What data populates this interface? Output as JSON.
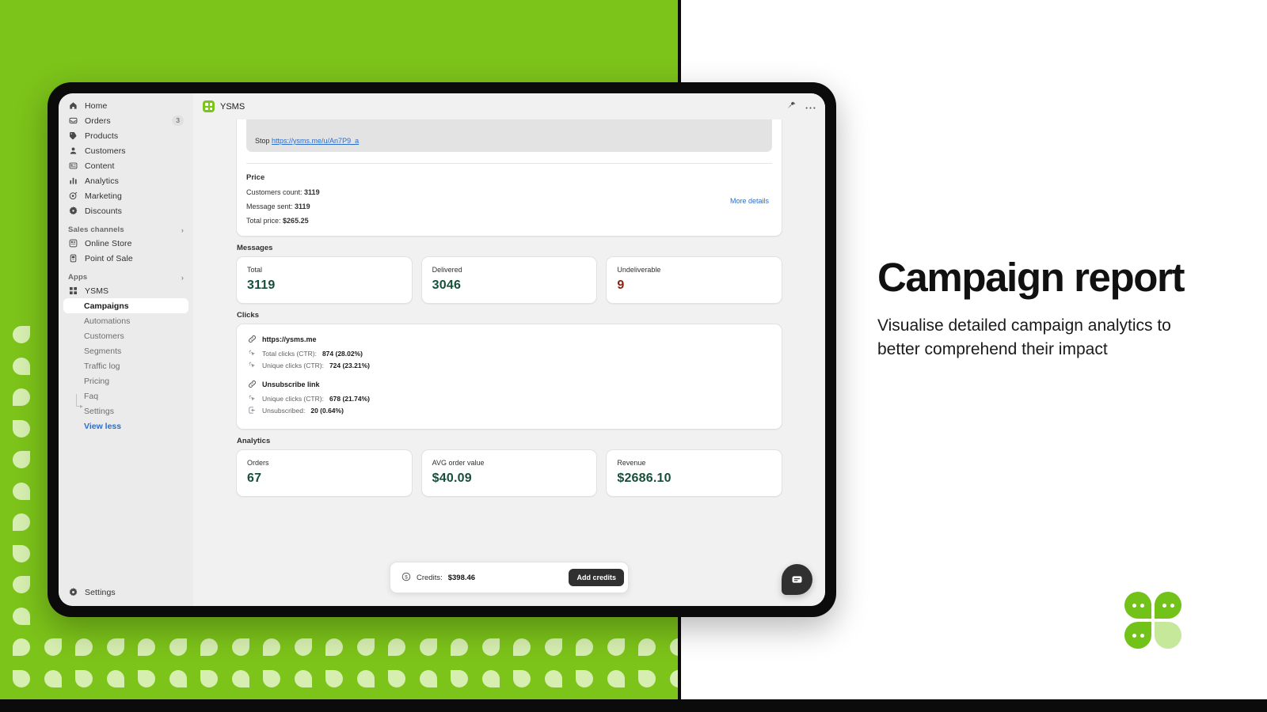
{
  "brand": {
    "green": "#7cc31a",
    "leaf": "#d6eeb0",
    "accent_link": "#2c6ecb",
    "value_green": "#17503a",
    "value_red": "#8e1f0b"
  },
  "topbar": {
    "app_name": "YSMS",
    "pin_icon": "pin-icon",
    "more_icon": "more-horizontal-icon"
  },
  "sidebar": {
    "main_items": [
      {
        "label": "Home",
        "icon": "home-icon",
        "badge": ""
      },
      {
        "label": "Orders",
        "icon": "orders-icon",
        "badge": "3"
      },
      {
        "label": "Products",
        "icon": "products-tag-icon",
        "badge": ""
      },
      {
        "label": "Customers",
        "icon": "customers-person-icon",
        "badge": ""
      },
      {
        "label": "Content",
        "icon": "content-icon",
        "badge": ""
      },
      {
        "label": "Analytics",
        "icon": "analytics-bars-icon",
        "badge": ""
      },
      {
        "label": "Marketing",
        "icon": "marketing-target-icon",
        "badge": ""
      },
      {
        "label": "Discounts",
        "icon": "discounts-icon",
        "badge": ""
      }
    ],
    "sales_channels": {
      "title": "Sales channels",
      "chevron": "›",
      "items": [
        {
          "label": "Online Store",
          "icon": "online-store-icon"
        },
        {
          "label": "Point of Sale",
          "icon": "point-of-sale-icon"
        }
      ]
    },
    "apps": {
      "title": "Apps",
      "chevron": "›",
      "root": {
        "label": "YSMS",
        "icon": "ysms-grid-icon"
      },
      "items": [
        {
          "label": "Campaigns",
          "active": true
        },
        {
          "label": "Automations",
          "active": false
        },
        {
          "label": "Customers",
          "active": false
        },
        {
          "label": "Segments",
          "active": false
        },
        {
          "label": "Traffic log",
          "active": false
        },
        {
          "label": "Pricing",
          "active": false
        },
        {
          "label": "Faq",
          "active": false
        },
        {
          "label": "Settings",
          "active": false
        }
      ],
      "view_less": "View less"
    },
    "bottom": {
      "label": "Settings",
      "icon": "gear-icon"
    }
  },
  "price_card": {
    "sms_preview": {
      "prefix": "Stop",
      "link_text": "https://ysms.me/u/An7P9_a"
    },
    "heading": "Price",
    "rows": [
      {
        "label": "Customers count:",
        "value": "3119"
      },
      {
        "label": "Message sent:",
        "value": "3119"
      },
      {
        "label": "Total price:",
        "value": "$265.25"
      }
    ],
    "more_details": "More details"
  },
  "messages": {
    "title": "Messages",
    "cards": [
      {
        "label": "Total",
        "value": "3119",
        "tone": "green"
      },
      {
        "label": "Delivered",
        "value": "3046",
        "tone": "green"
      },
      {
        "label": "Undeliverable",
        "value": "9",
        "tone": "red"
      }
    ]
  },
  "clicks": {
    "title": "Clicks",
    "groups": [
      {
        "head": "https://ysms.me",
        "head_icon": "link-icon",
        "rows": [
          {
            "icon": "click-icon",
            "label": "Total clicks (CTR):",
            "value": "874 (28.02%)"
          },
          {
            "icon": "click-icon",
            "label": "Unique clicks (CTR):",
            "value": "724 (23.21%)"
          }
        ]
      },
      {
        "head": "Unsubscribe link",
        "head_icon": "link-icon",
        "rows": [
          {
            "icon": "click-icon",
            "label": "Unique clicks (CTR):",
            "value": "678 (21.74%)"
          },
          {
            "icon": "unsubscribe-icon",
            "label": "Unsubscribed:",
            "value": "20 (0.64%)"
          }
        ]
      }
    ]
  },
  "analytics": {
    "title": "Analytics",
    "cards": [
      {
        "label": "Orders",
        "value": "67"
      },
      {
        "label": "AVG order value",
        "value": "$40.09"
      },
      {
        "label": "Revenue",
        "value": "$2686.10"
      }
    ]
  },
  "credits": {
    "icon": "dollar-circle-icon",
    "label": "Credits:",
    "amount": "$398.46",
    "button": "Add credits"
  },
  "chat_fab": {
    "icon": "chat-bubble-icon"
  },
  "marketing": {
    "headline": "Campaign report",
    "subcopy": "Visualise detailed campaign analytics to better comprehend their impact"
  }
}
